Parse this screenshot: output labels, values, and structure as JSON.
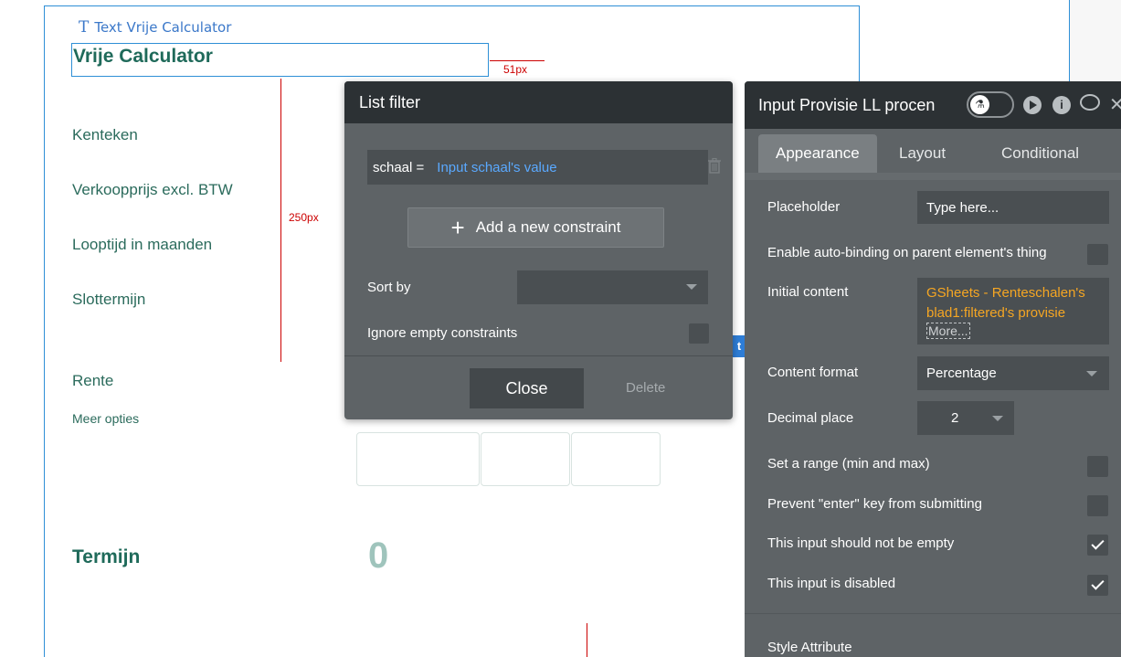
{
  "canvas": {
    "element_label": "Text Vrije Calculator",
    "page_title": "Vrije Calculator",
    "dim_horizontal": "51px",
    "dim_vertical": "250px",
    "fields": [
      "Kenteken",
      "Verkoopprijs excl. BTW",
      "Looptijd in maanden",
      "Slottermijn",
      "Rente"
    ],
    "more_options": "Meer opties",
    "term_label": "Termijn",
    "term_value": "0",
    "tag_char": "t"
  },
  "list_filter": {
    "title": "List filter",
    "constraint_key": "schaal =",
    "constraint_value": "Input schaal's value",
    "add_constraint": "Add a new constraint",
    "sort_by": "Sort by",
    "ignore_empty": "Ignore empty constraints",
    "close": "Close",
    "delete": "Delete"
  },
  "property_editor": {
    "title": "Input Provisie LL procen",
    "tabs": [
      "Appearance",
      "Layout",
      "Conditional"
    ],
    "placeholder_label": "Placeholder",
    "placeholder_value": "Type here...",
    "auto_binding_label": "Enable auto-binding on parent element's thing",
    "initial_content_label": "Initial content",
    "initial_content_value": "GSheets - Renteschalen's blad1:filtered's provisie",
    "more": "More...",
    "content_format_label": "Content format",
    "content_format_value": "Percentage",
    "decimal_place_label": "Decimal place",
    "decimal_place_value": "2",
    "range_label": "Set a range (min and max)",
    "prevent_enter_label": "Prevent \"enter\" key from submitting",
    "not_empty_label": "This input should not be empty",
    "disabled_label": "This input is disabled",
    "style_attribute_label": "Style Attribute",
    "checkbox_states": {
      "auto_binding": false,
      "range": false,
      "prevent_enter": false,
      "not_empty": true,
      "disabled": true
    }
  },
  "colors": {
    "accent_blue": "#2e8fd6",
    "title_green": "#1f6a5a",
    "dimension_red": "#cc0000",
    "dynamic_orange": "#f5a623",
    "panel_dark": "#2c3134",
    "panel_body": "#5e6366"
  }
}
